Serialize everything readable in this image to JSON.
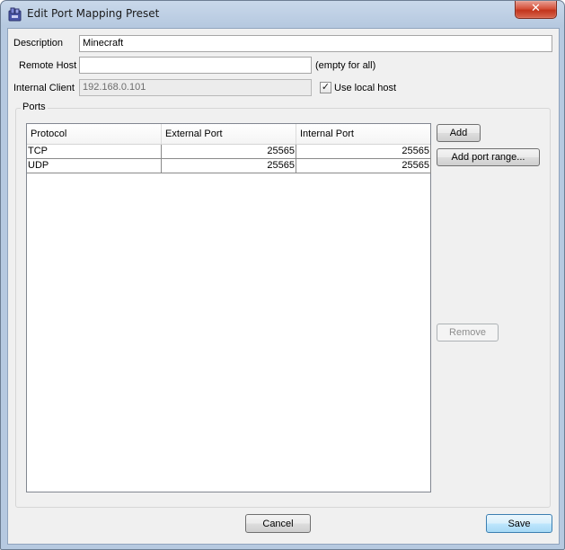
{
  "window": {
    "title": "Edit Port Mapping Preset",
    "close_glyph": "✕"
  },
  "form": {
    "description_label": "Description",
    "description_value": "Minecraft",
    "remote_host_label": "Remote Host",
    "remote_host_value": "",
    "remote_host_hint": "(empty for all)",
    "internal_client_label": "Internal Client",
    "internal_client_value": "192.168.0.101",
    "use_local_host_label": "Use local host",
    "use_local_host_checked": true,
    "check_glyph": "✓"
  },
  "ports": {
    "group_label": "Ports",
    "columns": [
      "Protocol",
      "External Port",
      "Internal Port"
    ],
    "rows": [
      {
        "protocol": "TCP",
        "external": "25565",
        "internal": "25565"
      },
      {
        "protocol": "UDP",
        "external": "25565",
        "internal": "25565"
      }
    ],
    "add_label": "Add",
    "add_range_label": "Add port range...",
    "remove_label": "Remove"
  },
  "footer": {
    "cancel_label": "Cancel",
    "save_label": "Save"
  }
}
